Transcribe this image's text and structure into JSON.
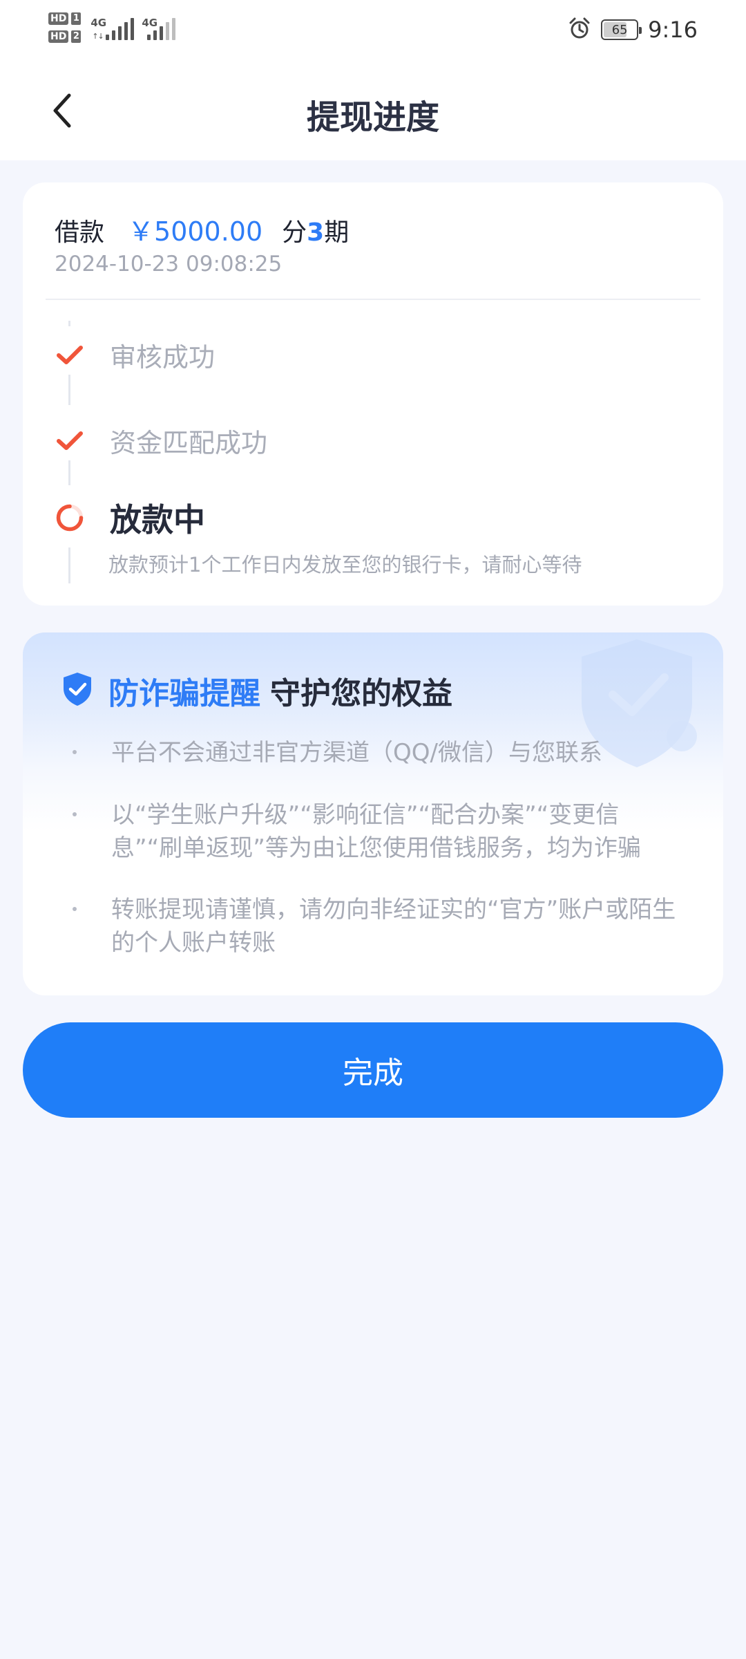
{
  "status_bar": {
    "hd_badge": "HD",
    "sim1": "1",
    "sim2": "2",
    "network_1": "4G",
    "network_2": "4G",
    "arrows": "↑↓",
    "battery_level": "65",
    "time": "9:16"
  },
  "header": {
    "title": "提现进度"
  },
  "loan": {
    "label": "借款",
    "amount": "￥5000.00",
    "period_prefix": "分",
    "period_num": "3",
    "period_suffix": "期",
    "datetime": "2024-10-23 09:08:25"
  },
  "steps": [
    {
      "label": "审核成功",
      "state": "done"
    },
    {
      "label": "资金匹配成功",
      "state": "done"
    },
    {
      "label": "放款中",
      "state": "active",
      "desc": "放款预计1个工作日内发放至您的银行卡，请耐心等待"
    }
  ],
  "fraud": {
    "title": "防诈骗提醒",
    "subtitle": "守护您的权益",
    "items": [
      "平台不会通过非官方渠道（QQ/微信）与您联系",
      "以“学生账户升级”“影响征信”“配合办案”“变更信息”“刷单返现”等为由让您使用借钱服务，均为诈骗",
      "转账提现请谨慎，请勿向非经证实的“官方”账户或陌生的个人账户转账"
    ]
  },
  "done_button": {
    "label": "完成"
  },
  "colors": {
    "accent": "#1f7ef8",
    "check": "#f0553a",
    "page_bg": "#f4f6fd"
  }
}
